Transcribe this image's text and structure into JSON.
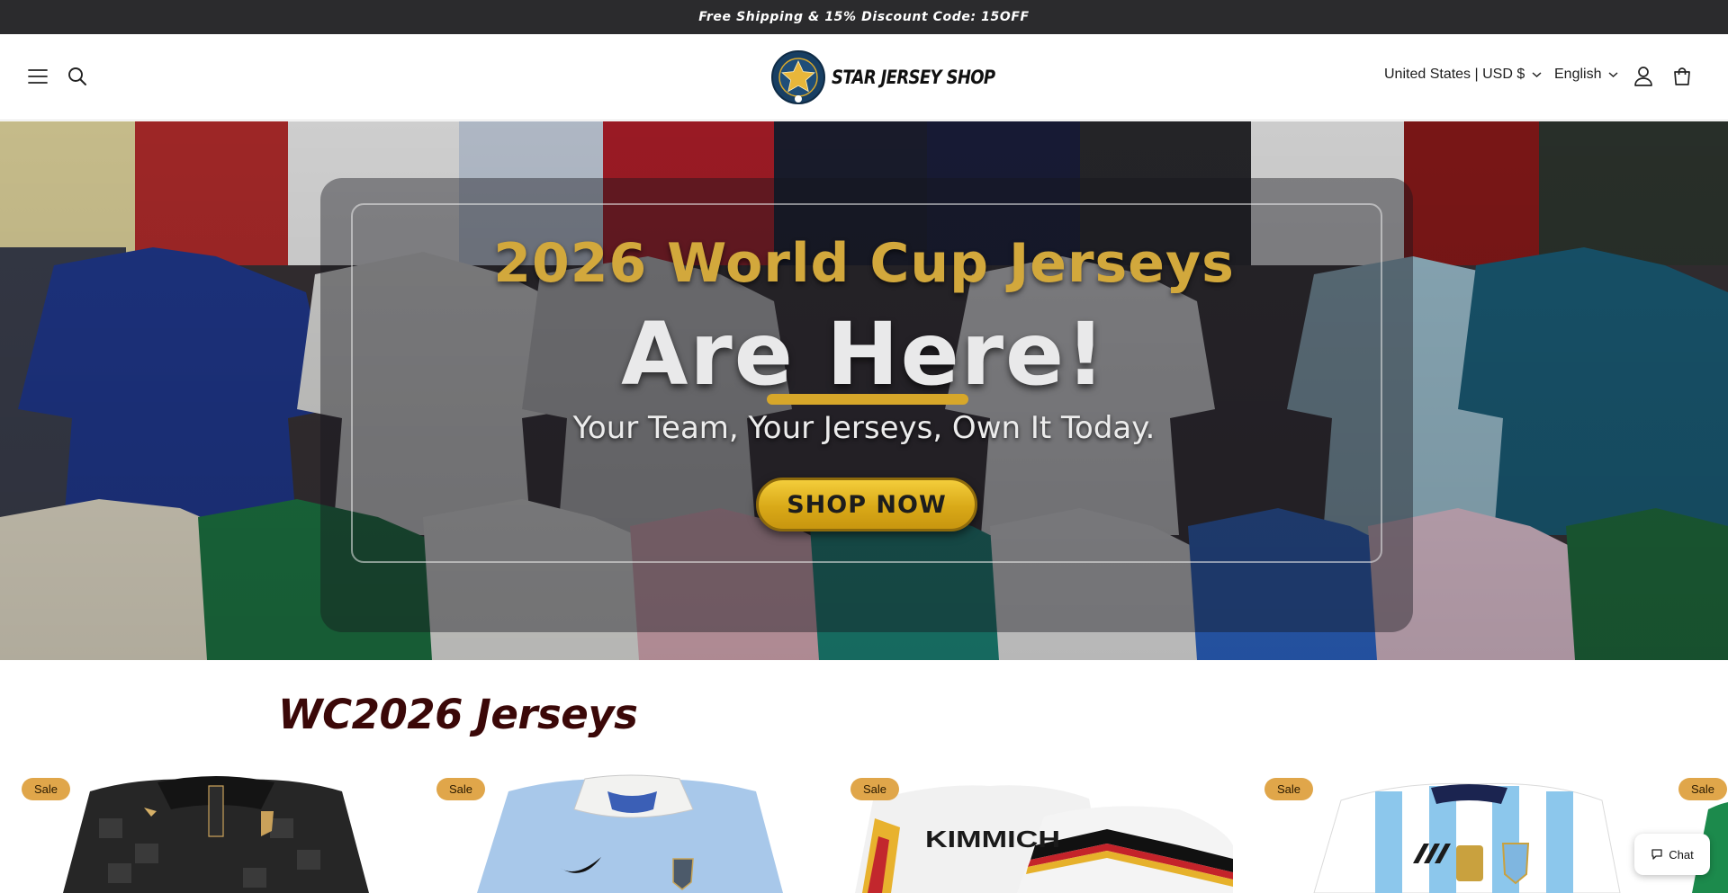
{
  "announcement": {
    "text": "Free Shipping & 15% Discount Code: 15OFF"
  },
  "header": {
    "logo_text": "STAR JERSEY SHOP",
    "currency_label": "United States | USD $",
    "language_label": "English"
  },
  "hero": {
    "line1": "2026 World Cup Jerseys",
    "line2": "Are Here!",
    "line3": "Your Team, Your Jerseys, Own It Today.",
    "cta_label": "SHOP NOW"
  },
  "collection": {
    "title": "WC2026 Jerseys",
    "products": [
      {
        "badge": "Sale",
        "text": ""
      },
      {
        "badge": "Sale",
        "text": ""
      },
      {
        "badge": "Sale",
        "text": "KIMMICH"
      },
      {
        "badge": "Sale",
        "text": ""
      },
      {
        "badge": "Sale",
        "text": ""
      }
    ]
  },
  "chat": {
    "label": "Chat"
  },
  "colors": {
    "announcement_bg": "#2b2b2d",
    "badge_bg": "#e0a64a",
    "title_color": "#3b0808",
    "cta_gold": "#d9a918",
    "hero_gold_text": "#d2a83c"
  },
  "icons": [
    "menu-icon",
    "search-icon",
    "chevron-down-icon",
    "account-icon",
    "cart-icon",
    "chat-icon"
  ]
}
